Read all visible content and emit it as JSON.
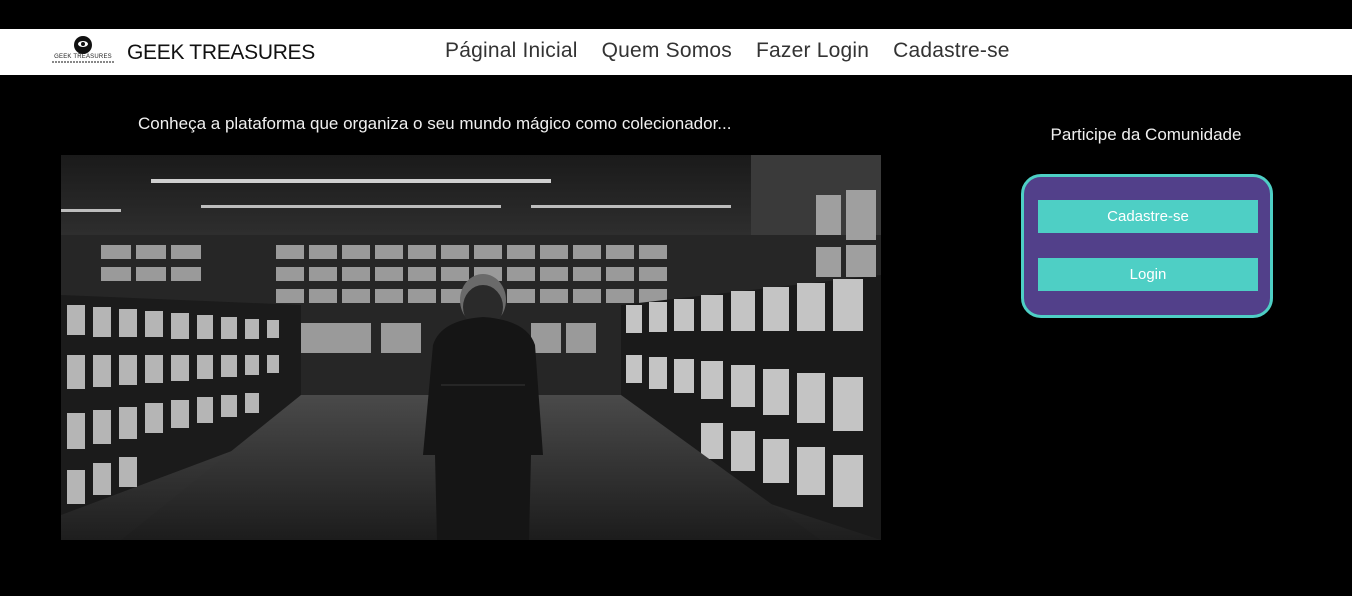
{
  "header": {
    "logo_text": "GEEK TREASURES",
    "brand": "GEEK TREASURES",
    "nav": [
      {
        "label": "Páginal Inicial"
      },
      {
        "label": "Quem Somos"
      },
      {
        "label": "Fazer Login"
      },
      {
        "label": "Cadastre-se"
      }
    ]
  },
  "main": {
    "tagline": "Conheça a plataforma que organiza o seu mundo mágico como colecionador..."
  },
  "community": {
    "title": "Participe da Comunidade",
    "signup_label": "Cadastre-se",
    "login_label": "Login"
  },
  "colors": {
    "background": "#000000",
    "card": "#52408a",
    "accent": "#4ecfc5"
  },
  "icons": [
    "eye-logo-icon"
  ]
}
